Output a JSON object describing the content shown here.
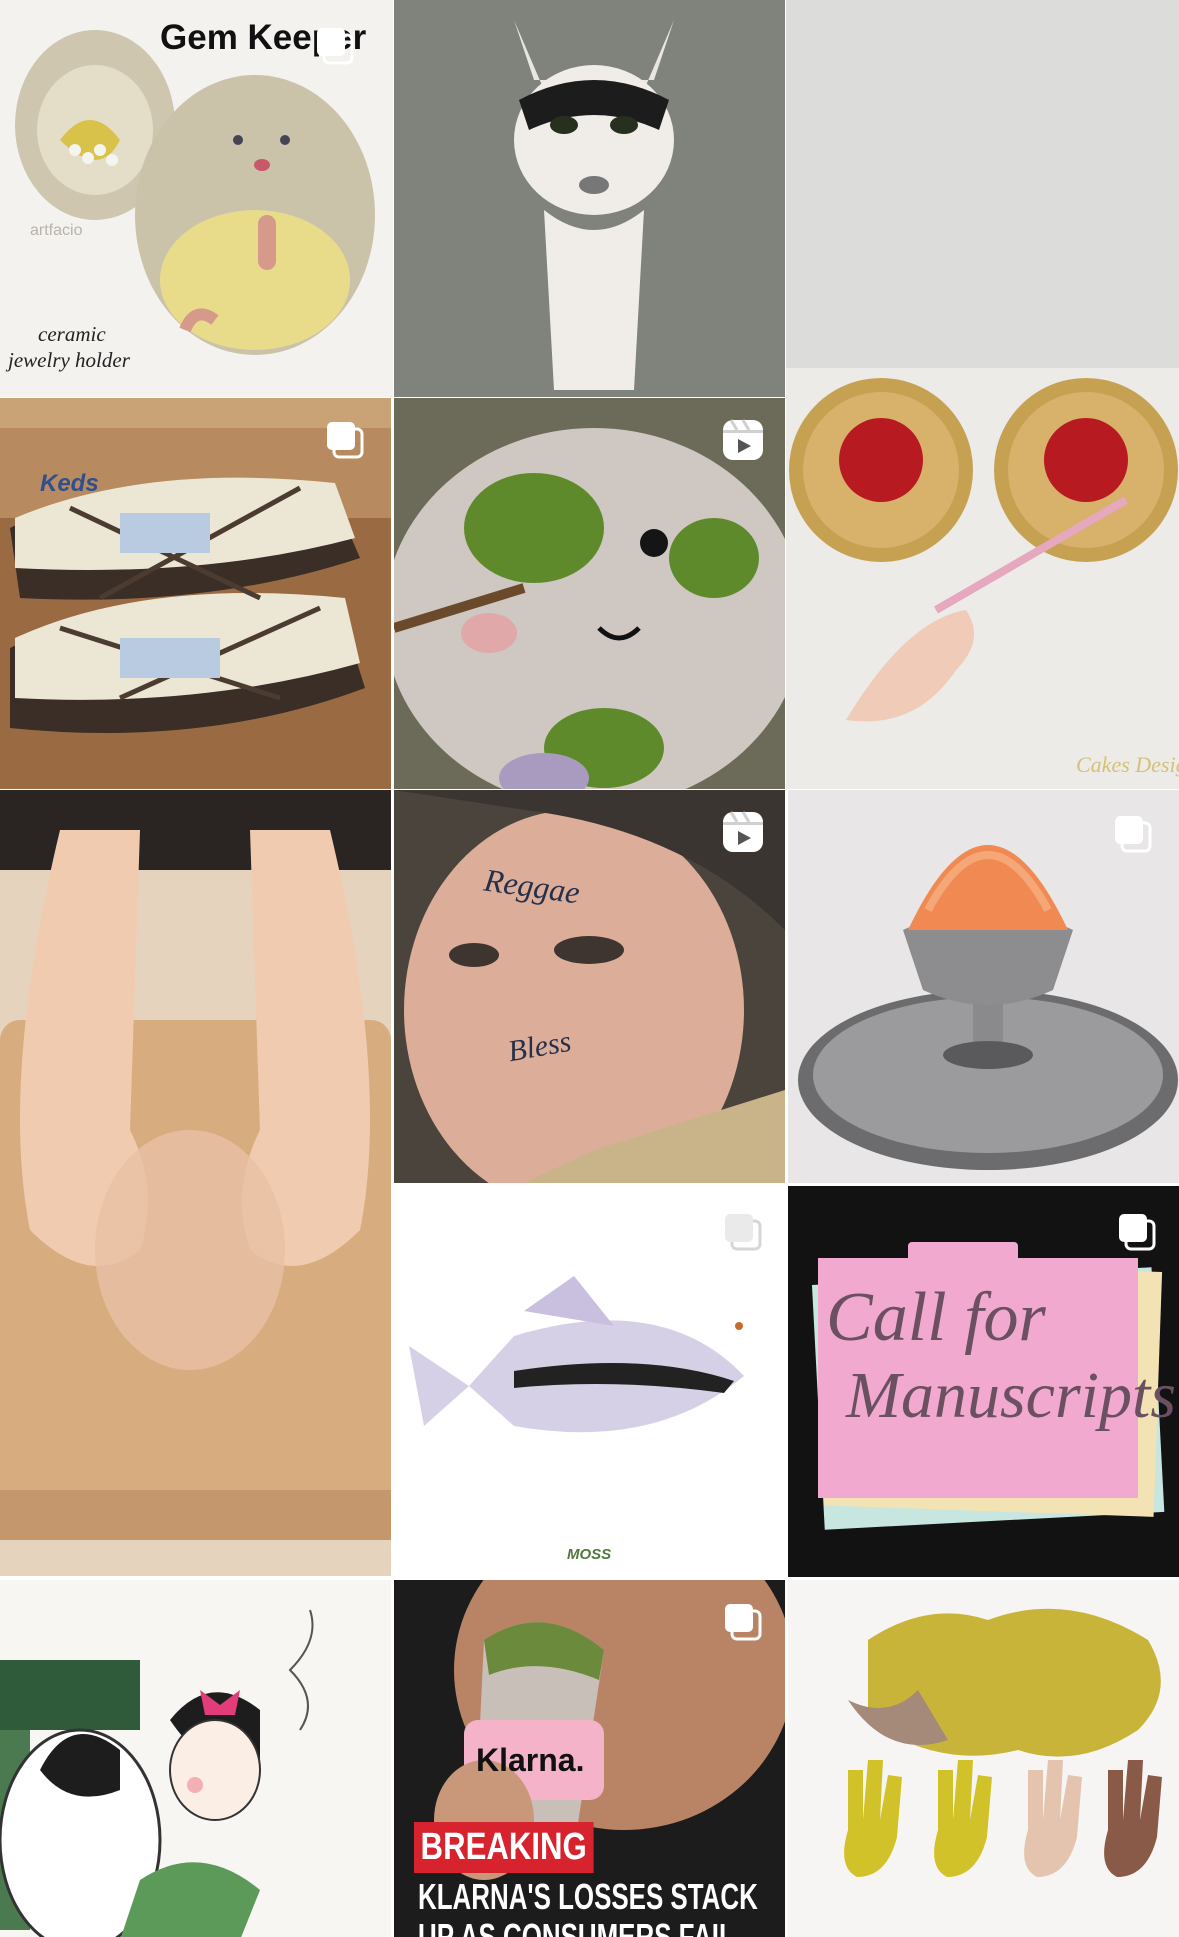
{
  "grid": {
    "columns": 3,
    "posts": [
      {
        "id": "post-gem-keeper",
        "badge": "carousel-icon",
        "texts": {
          "title": "Gem Keeper",
          "caption1": "ceramic",
          "caption2": "jewelry holder",
          "watermark": "artfacio"
        }
      },
      {
        "id": "post-cat-video",
        "badge": "none"
      },
      {
        "id": "post-spaghetti-cake",
        "badge": "none",
        "texts": {
          "brand": "Cakes Design"
        }
      },
      {
        "id": "post-keds-sneakers",
        "badge": "carousel-icon",
        "texts": {
          "box": "Keds"
        }
      },
      {
        "id": "post-felt-creature",
        "badge": "reel-icon"
      },
      {
        "id": "post-hands-cutting-board",
        "badge": "none"
      },
      {
        "id": "post-face-tattoo",
        "badge": "reel-icon",
        "texts": {
          "tattoo1": "Reggae",
          "tattoo2": "Bless"
        }
      },
      {
        "id": "post-orange-dessert",
        "badge": "carousel-icon"
      },
      {
        "id": "post-halftone-fish",
        "badge": "carousel-icon",
        "texts": {
          "label": "MOSS"
        }
      },
      {
        "id": "post-call-for-manuscripts",
        "badge": "carousel-icon",
        "texts": {
          "line1": "Call for",
          "line2": "Manuscripts"
        }
      },
      {
        "id": "post-illustration-couple",
        "badge": "none"
      },
      {
        "id": "post-klarna-breaking",
        "badge": "carousel-icon",
        "texts": {
          "brand": "Klarna.",
          "breaking": "BREAKING",
          "headline1": "KLARNA'S LOSSES STACK",
          "headline2": "UP AS CONSUMERS FAIL"
        }
      },
      {
        "id": "post-yellow-sponge-hands",
        "badge": "none"
      }
    ]
  }
}
